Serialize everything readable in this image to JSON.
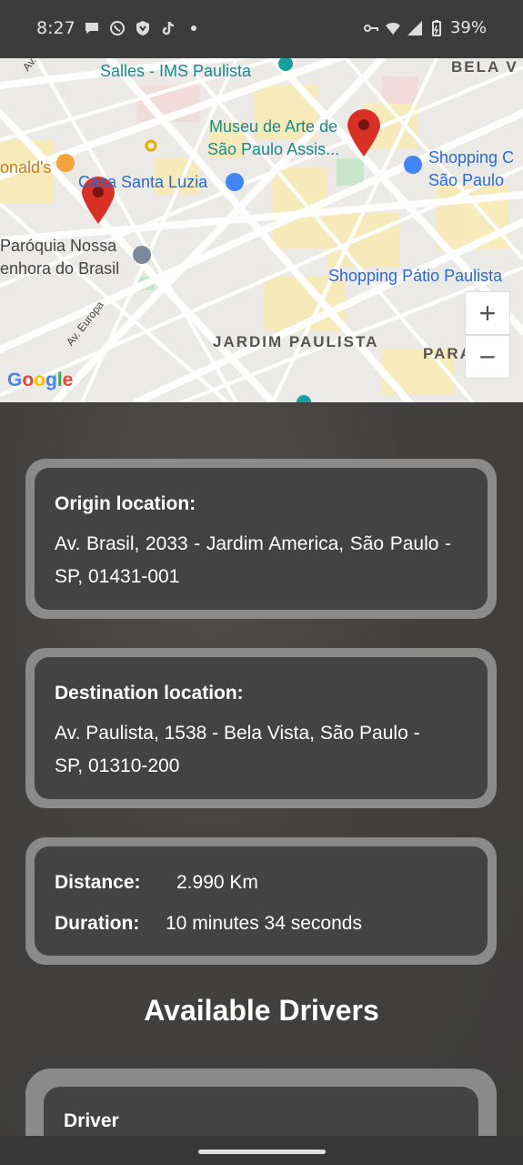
{
  "status_bar": {
    "time": "8:27",
    "battery": "39%",
    "left_icons": [
      "message-icon",
      "viber-icon",
      "shield-icon",
      "tiktok-icon",
      "dot-icon"
    ],
    "right_icons": [
      "vpn-key-icon",
      "wifi-icon",
      "signal-icon",
      "battery-icon"
    ]
  },
  "map": {
    "labels": {
      "salles": "Salles - IMS Paulista",
      "bela_vista": "BELA V",
      "museu_1": "Museu de Arte de",
      "museu_2": "São Paulo Assis...",
      "mcdonalds": "onald's",
      "casa_santa_luzia": "Casa Santa Luzia",
      "shopping_c_1": "Shopping C",
      "shopping_c_2": "São Paulo",
      "paroquia_1": "Paróquia Nossa",
      "paroquia_2": "enhora do Brasil",
      "shopping_patio": "Shopping Pátio Paulista",
      "jardim_paulista": "JARDIM PAULISTA",
      "paraiso": "PARAÍSO",
      "av_europa": "Av. Europa",
      "av_top": "Av."
    },
    "zoom_in": "+",
    "zoom_out": "−",
    "google": [
      "G",
      "o",
      "o",
      "g",
      "l",
      "e"
    ],
    "pin_color": "#d93025"
  },
  "origin": {
    "title": "Origin location:",
    "address": "Av. Brasil, 2033 - Jardim America, São Paulo - SP, 01431-001"
  },
  "destination": {
    "title": "Destination location:",
    "address": "Av. Paulista, 1538 - Bela Vista, São Paulo - SP, 01310-200"
  },
  "trip": {
    "distance_label": "Distance:",
    "distance_value": "2.990 Km",
    "duration_label": "Duration:",
    "duration_value": "10 minutes 34 seconds"
  },
  "drivers": {
    "section_title": "Available Drivers",
    "first_card_label": "Driver"
  }
}
